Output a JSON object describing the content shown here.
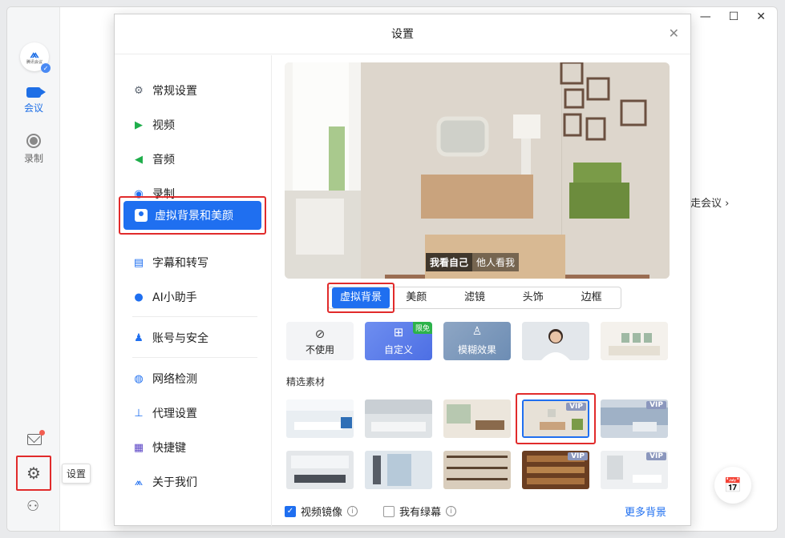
{
  "app": {
    "logo_text": "腾讯会议",
    "rail": {
      "meeting_label": "会议",
      "record_label": "录制",
      "settings_tooltip": "设置"
    },
    "background_link": "走会议",
    "window_controls": [
      "—",
      "☐",
      "✕"
    ]
  },
  "dialog": {
    "title": "设置",
    "close_icon": "close-icon",
    "nav": [
      {
        "label": "常规设置",
        "icon": "gear-icon"
      },
      {
        "label": "视频",
        "icon": "camera-icon"
      },
      {
        "label": "音频",
        "icon": "speaker-icon"
      },
      {
        "label": "录制",
        "icon": "record-icon"
      },
      {
        "label": "虚拟背景和美颜",
        "icon": "portrait-icon",
        "selected": true
      },
      {
        "label": "字幕和转写",
        "icon": "subtitle-icon"
      },
      {
        "label": "AI小助手",
        "icon": "ai-bot-icon"
      },
      {
        "label": "账号与安全",
        "icon": "account-icon"
      },
      {
        "label": "网络检测",
        "icon": "globe-icon"
      },
      {
        "label": "代理设置",
        "icon": "proxy-icon"
      },
      {
        "label": "快捷键",
        "icon": "keyboard-icon"
      },
      {
        "label": "关于我们",
        "icon": "about-icon"
      }
    ],
    "preview": {
      "self_view": "我看自己",
      "others_view": "他人看我"
    },
    "tabs": [
      "虚拟背景",
      "美颜",
      "滤镜",
      "头饰",
      "边框"
    ],
    "active_tab": "虚拟背景",
    "options": {
      "none": "不使用",
      "custom": "自定义",
      "custom_tag": "限免",
      "blur": "模糊效果"
    },
    "section_label": "精选素材",
    "vip_badge": "VIP",
    "footer": {
      "mirror_label": "视频镜像",
      "mirror_checked": true,
      "greenscreen_label": "我有绿幕",
      "greenscreen_checked": false,
      "more_backgrounds": "更多背景"
    }
  },
  "colors": {
    "accent": "#1f6ff0",
    "highlight_border": "#e12b2b"
  }
}
